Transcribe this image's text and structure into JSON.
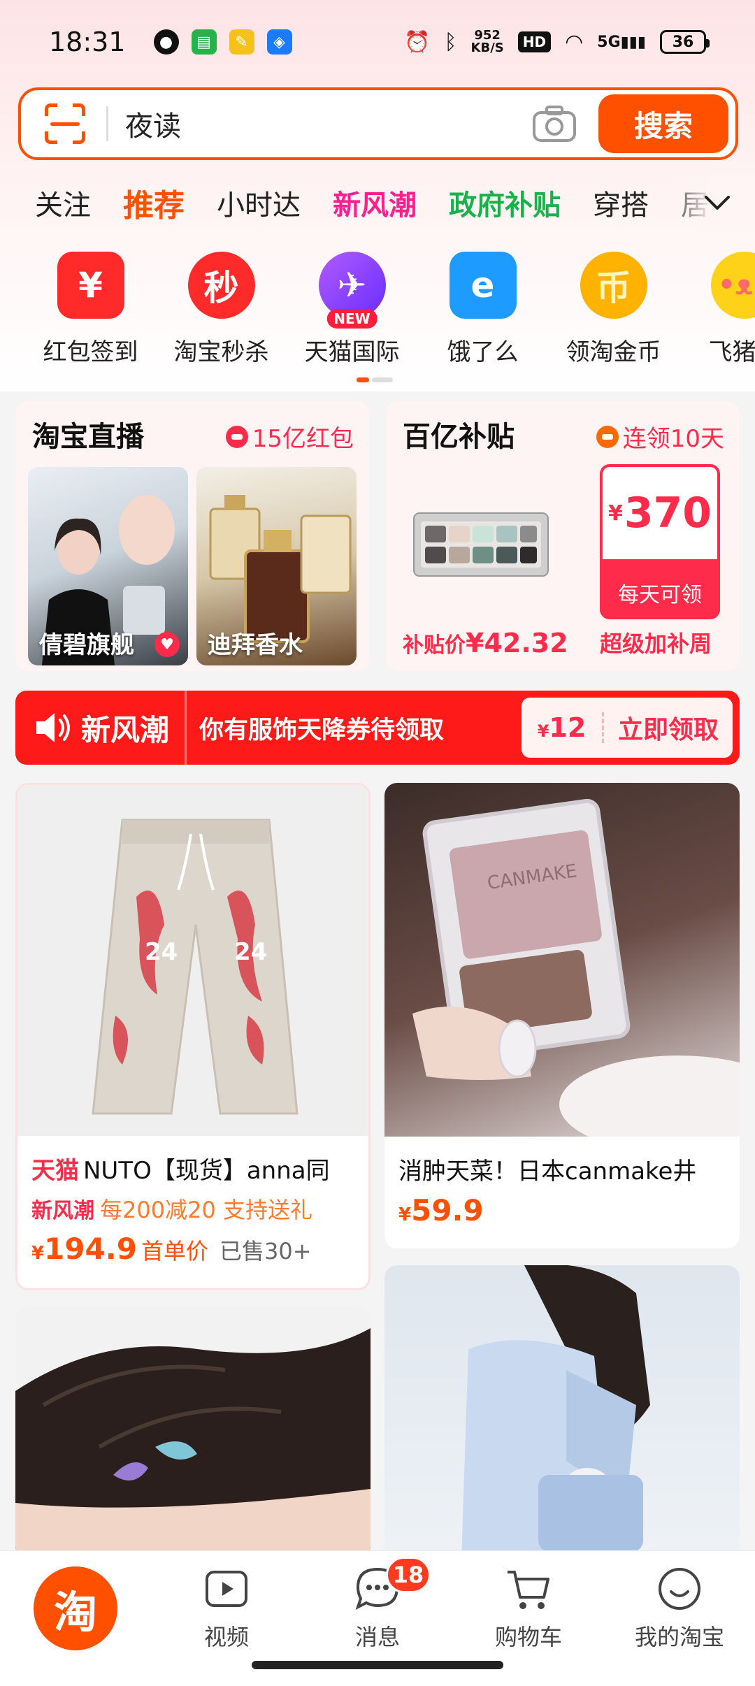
{
  "status_bar": {
    "time": "18:31",
    "net_speed_value": "952",
    "net_speed_unit": "KB/S",
    "hd": "HD",
    "signal": "5G",
    "battery": "36"
  },
  "search": {
    "query": "夜读",
    "button": "搜索"
  },
  "tabs": [
    {
      "label": "关注",
      "style": "normal"
    },
    {
      "label": "推荐",
      "style": "active"
    },
    {
      "label": "小时达",
      "style": "normal"
    },
    {
      "label": "新风潮",
      "style": "pink"
    },
    {
      "label": "政府补贴",
      "style": "green"
    },
    {
      "label": "穿搭",
      "style": "normal"
    },
    {
      "label": "居家",
      "style": "fade"
    }
  ],
  "shortcuts": [
    {
      "label": "红包签到",
      "icon": "red-envelope-icon",
      "color": "#ff2b2b",
      "glyph": "¥"
    },
    {
      "label": "淘宝秒杀",
      "icon": "flash-sale-clock-icon",
      "color": "#ff2b2b",
      "glyph": "秒"
    },
    {
      "label": "天猫国际",
      "icon": "plane-planet-icon",
      "color": "#8a3cff",
      "glyph": "✈",
      "tag": "NEW"
    },
    {
      "label": "饿了么",
      "icon": "eleme-icon",
      "color": "#1e9bff",
      "glyph": "e"
    },
    {
      "label": "领淘金币",
      "icon": "gold-coin-icon",
      "color": "#ffb300",
      "glyph": "币"
    },
    {
      "label": "飞猪旅",
      "icon": "fliggy-pig-icon",
      "color": "#ffd21a",
      "glyph": "🐷"
    }
  ],
  "live": {
    "title": "淘宝直播",
    "tag": "15亿红包",
    "items": [
      {
        "caption": "倩碧旗舰"
      },
      {
        "caption": "迪拜香水"
      }
    ]
  },
  "subsidy": {
    "title": "百亿补贴",
    "tag": "连领10天",
    "price_label": "补贴价",
    "price": "¥42.32",
    "coupon_currency": "¥",
    "coupon_amount": "370",
    "coupon_note": "每天可领",
    "right_label": "超级加补周"
  },
  "banner": {
    "brand": "新风潮",
    "text": "你有服饰天降券待领取",
    "coupon_currency": "¥",
    "coupon_amount": "12",
    "action": "立即领取"
  },
  "products": [
    {
      "prefix": "天猫",
      "title": "NUTO【现货】anna同",
      "tag": "新风潮",
      "promo": "每200减20 支持送礼",
      "currency": "¥",
      "price": "194.9",
      "unit": "首单价",
      "sold": "已售30+"
    },
    {
      "title": "消肿天菜！日本canmake井",
      "currency": "¥",
      "price": "59.9"
    }
  ],
  "bottom_nav": {
    "home": "淘",
    "video": "视频",
    "messages": "消息",
    "messages_badge": "18",
    "cart": "购物车",
    "mine": "我的淘宝"
  }
}
